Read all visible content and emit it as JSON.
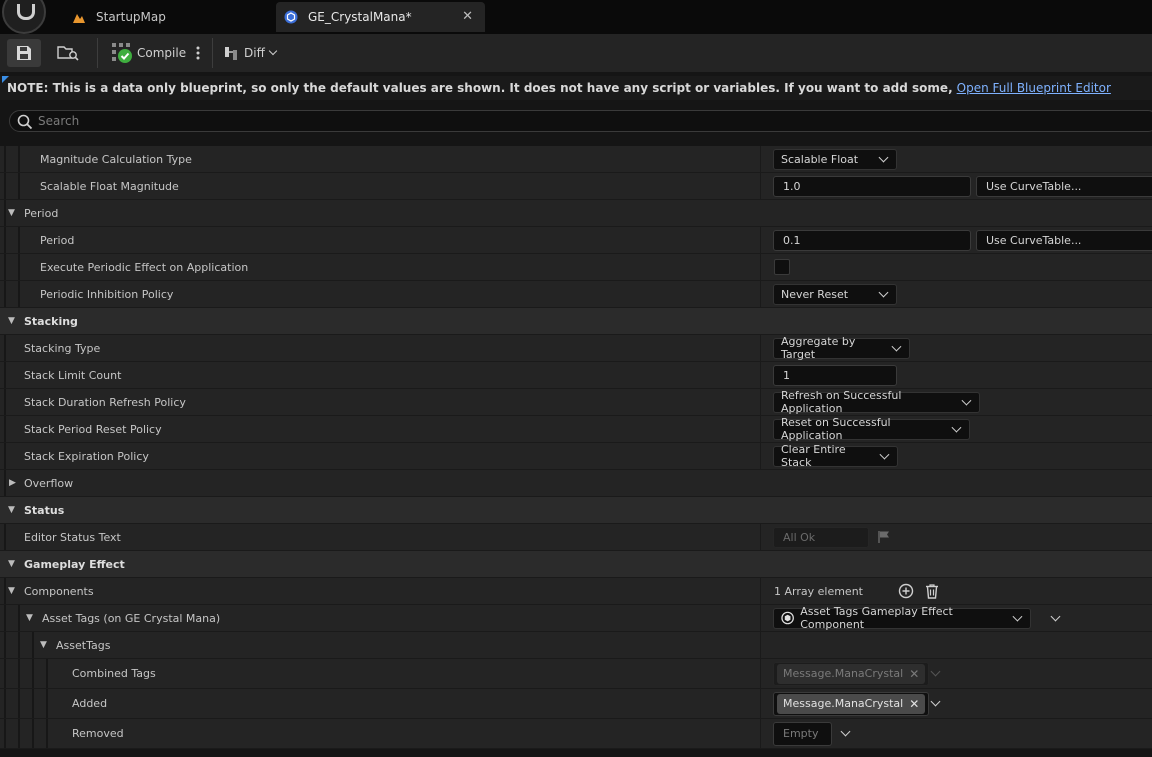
{
  "tabs": [
    {
      "label": "StartupMap",
      "icon": "level-map-icon"
    },
    {
      "label": "GE_CrystalMana*",
      "icon": "blueprint-icon",
      "close": "✕"
    }
  ],
  "toolbar": {
    "compile_label": "Compile",
    "diff_label": "Diff"
  },
  "note": {
    "text": "NOTE: This is a data only blueprint, so only the default values are shown.  It does not have any script or variables.  If you want to add some,",
    "link": "Open Full Blueprint Editor"
  },
  "search": {
    "placeholder": "Search"
  },
  "rows": {
    "magnitude_calc_type": {
      "label": "Magnitude Calculation Type",
      "value": "Scalable Float"
    },
    "scalable_float_magnitude": {
      "label": "Scalable Float Magnitude",
      "value": "1.0",
      "curve": "Use CurveTable..."
    },
    "period_cat": {
      "label": "Period"
    },
    "period": {
      "label": "Period",
      "value": "0.1",
      "curve": "Use CurveTable..."
    },
    "execute_periodic": {
      "label": "Execute Periodic Effect on Application",
      "checked": false
    },
    "periodic_inhibition": {
      "label": "Periodic Inhibition Policy",
      "value": "Never Reset"
    },
    "stacking_cat": {
      "label": "Stacking"
    },
    "stacking_type": {
      "label": "Stacking Type",
      "value": "Aggregate by Target"
    },
    "stack_limit": {
      "label": "Stack Limit Count",
      "value": "1"
    },
    "stack_duration_refresh": {
      "label": "Stack Duration Refresh Policy",
      "value": "Refresh on Successful Application"
    },
    "stack_period_reset": {
      "label": "Stack Period Reset Policy",
      "value": "Reset on Successful Application"
    },
    "stack_expiration": {
      "label": "Stack Expiration Policy",
      "value": "Clear Entire Stack"
    },
    "overflow": {
      "label": "Overflow"
    },
    "status_cat": {
      "label": "Status"
    },
    "editor_status": {
      "label": "Editor Status Text",
      "value": "All Ok"
    },
    "gameplay_effect_cat": {
      "label": "Gameplay Effect"
    },
    "components": {
      "label": "Components",
      "value": "1 Array element"
    },
    "asset_tags_component": {
      "label": "Asset Tags (on GE Crystal Mana)",
      "value": "Asset Tags Gameplay Effect Component"
    },
    "asset_tags": {
      "label": "AssetTags"
    },
    "combined_tags": {
      "label": "Combined Tags",
      "value": "Message.ManaCrystal"
    },
    "added": {
      "label": "Added",
      "value": "Message.ManaCrystal"
    },
    "removed": {
      "label": "Removed",
      "value": "Empty"
    }
  },
  "colors": {
    "background": "#242424",
    "category": "#2b2b2b",
    "link": "#7fb2ff",
    "accent": "#3a8ee6"
  }
}
